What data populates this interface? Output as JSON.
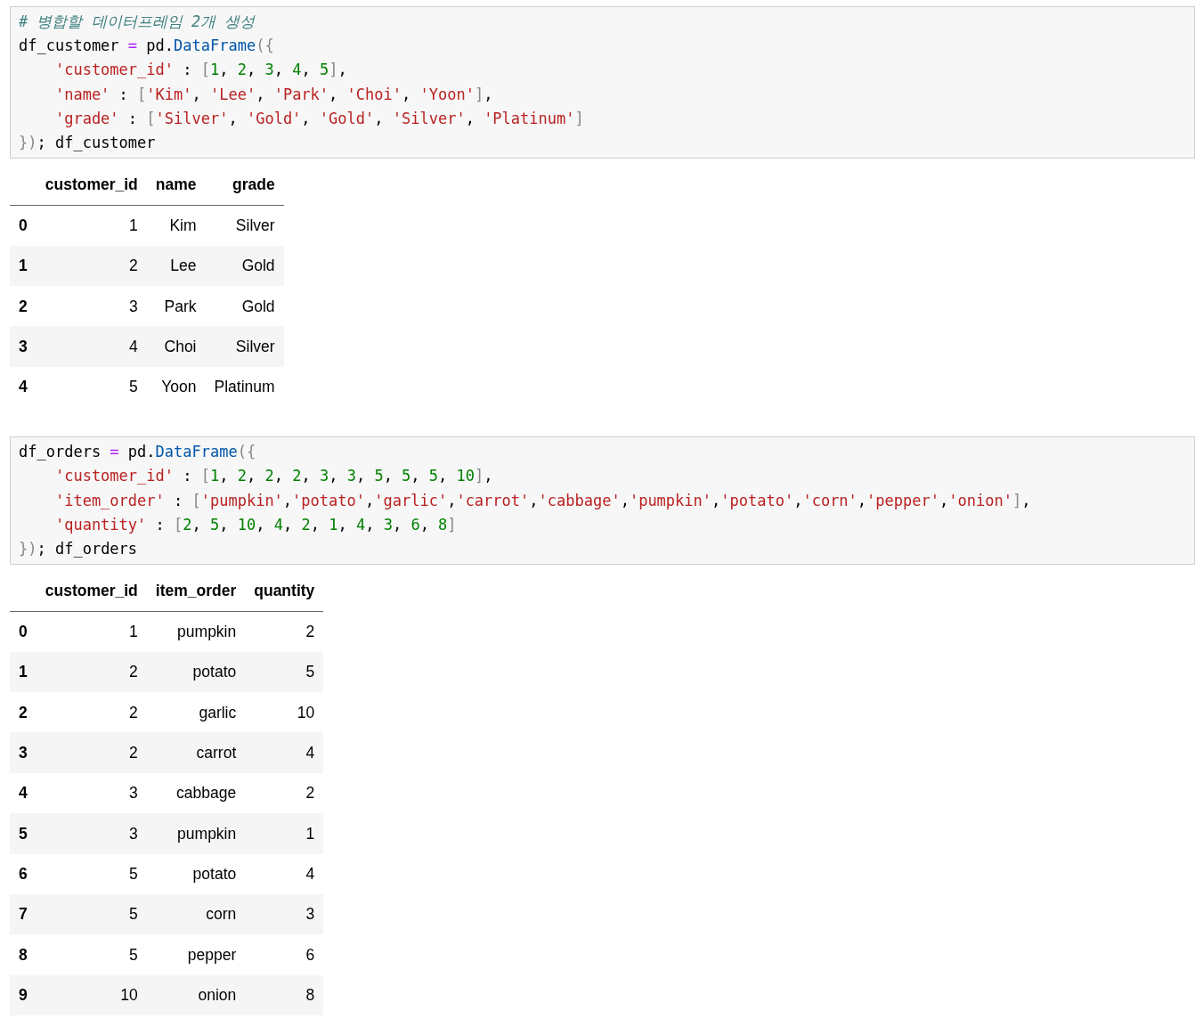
{
  "cells": [
    {
      "code": [
        {
          "indent": false,
          "tokens": [
            {
              "kind": "comment",
              "text": "# 병합할 데이터프레임 2개 생성"
            }
          ]
        },
        {
          "indent": false,
          "tokens": [
            {
              "kind": "plain",
              "text": "df_customer "
            },
            {
              "kind": "op",
              "text": "="
            },
            {
              "kind": "plain",
              "text": " pd."
            },
            {
              "kind": "attr",
              "text": "DataFrame"
            },
            {
              "kind": "punct",
              "text": "({"
            }
          ]
        },
        {
          "indent": true,
          "tokens": [
            {
              "kind": "str",
              "text": "'customer_id'"
            },
            {
              "kind": "plain",
              "text": " : "
            },
            {
              "kind": "punct",
              "text": "["
            },
            {
              "kind": "num",
              "text": "1"
            },
            {
              "kind": "plain",
              "text": ", "
            },
            {
              "kind": "num",
              "text": "2"
            },
            {
              "kind": "plain",
              "text": ", "
            },
            {
              "kind": "num",
              "text": "3"
            },
            {
              "kind": "plain",
              "text": ", "
            },
            {
              "kind": "num",
              "text": "4"
            },
            {
              "kind": "plain",
              "text": ", "
            },
            {
              "kind": "num",
              "text": "5"
            },
            {
              "kind": "punct",
              "text": "]"
            },
            {
              "kind": "plain",
              "text": ","
            }
          ]
        },
        {
          "indent": true,
          "tokens": [
            {
              "kind": "str",
              "text": "'name'"
            },
            {
              "kind": "plain",
              "text": " : "
            },
            {
              "kind": "punct",
              "text": "["
            },
            {
              "kind": "str",
              "text": "'Kim'"
            },
            {
              "kind": "plain",
              "text": ", "
            },
            {
              "kind": "str",
              "text": "'Lee'"
            },
            {
              "kind": "plain",
              "text": ", "
            },
            {
              "kind": "str",
              "text": "'Park'"
            },
            {
              "kind": "plain",
              "text": ", "
            },
            {
              "kind": "str",
              "text": "'Choi'"
            },
            {
              "kind": "plain",
              "text": ", "
            },
            {
              "kind": "str",
              "text": "'Yoon'"
            },
            {
              "kind": "punct",
              "text": "]"
            },
            {
              "kind": "plain",
              "text": ","
            }
          ]
        },
        {
          "indent": true,
          "tokens": [
            {
              "kind": "str",
              "text": "'grade'"
            },
            {
              "kind": "plain",
              "text": " : "
            },
            {
              "kind": "punct",
              "text": "["
            },
            {
              "kind": "str",
              "text": "'Silver'"
            },
            {
              "kind": "plain",
              "text": ", "
            },
            {
              "kind": "str",
              "text": "'Gold'"
            },
            {
              "kind": "plain",
              "text": ", "
            },
            {
              "kind": "str",
              "text": "'Gold'"
            },
            {
              "kind": "plain",
              "text": ", "
            },
            {
              "kind": "str",
              "text": "'Silver'"
            },
            {
              "kind": "plain",
              "text": ", "
            },
            {
              "kind": "str",
              "text": "'Platinum'"
            },
            {
              "kind": "punct",
              "text": "]"
            }
          ]
        },
        {
          "indent": false,
          "tokens": [
            {
              "kind": "punct",
              "text": "})"
            },
            {
              "kind": "plain",
              "text": "; df_customer"
            }
          ]
        }
      ],
      "table": {
        "columns": [
          "",
          "customer_id",
          "name",
          "grade"
        ],
        "rows": [
          [
            "0",
            "1",
            "Kim",
            "Silver"
          ],
          [
            "1",
            "2",
            "Lee",
            "Gold"
          ],
          [
            "2",
            "3",
            "Park",
            "Gold"
          ],
          [
            "3",
            "4",
            "Choi",
            "Silver"
          ],
          [
            "4",
            "5",
            "Yoon",
            "Platinum"
          ]
        ]
      }
    },
    {
      "code": [
        {
          "indent": false,
          "tokens": [
            {
              "kind": "plain",
              "text": "df_orders "
            },
            {
              "kind": "op",
              "text": "="
            },
            {
              "kind": "plain",
              "text": " pd."
            },
            {
              "kind": "attr",
              "text": "DataFrame"
            },
            {
              "kind": "punct",
              "text": "({"
            }
          ]
        },
        {
          "indent": true,
          "tokens": [
            {
              "kind": "str",
              "text": "'customer_id'"
            },
            {
              "kind": "plain",
              "text": " : "
            },
            {
              "kind": "punct",
              "text": "["
            },
            {
              "kind": "num",
              "text": "1"
            },
            {
              "kind": "plain",
              "text": ", "
            },
            {
              "kind": "num",
              "text": "2"
            },
            {
              "kind": "plain",
              "text": ", "
            },
            {
              "kind": "num",
              "text": "2"
            },
            {
              "kind": "plain",
              "text": ", "
            },
            {
              "kind": "num",
              "text": "2"
            },
            {
              "kind": "plain",
              "text": ", "
            },
            {
              "kind": "num",
              "text": "3"
            },
            {
              "kind": "plain",
              "text": ", "
            },
            {
              "kind": "num",
              "text": "3"
            },
            {
              "kind": "plain",
              "text": ", "
            },
            {
              "kind": "num",
              "text": "5"
            },
            {
              "kind": "plain",
              "text": ", "
            },
            {
              "kind": "num",
              "text": "5"
            },
            {
              "kind": "plain",
              "text": ", "
            },
            {
              "kind": "num",
              "text": "5"
            },
            {
              "kind": "plain",
              "text": ", "
            },
            {
              "kind": "num",
              "text": "10"
            },
            {
              "kind": "punct",
              "text": "]"
            },
            {
              "kind": "plain",
              "text": ","
            }
          ]
        },
        {
          "indent": true,
          "tokens": [
            {
              "kind": "str",
              "text": "'item_order'"
            },
            {
              "kind": "plain",
              "text": " : "
            },
            {
              "kind": "punct",
              "text": "["
            },
            {
              "kind": "str",
              "text": "'pumpkin'"
            },
            {
              "kind": "plain",
              "text": ","
            },
            {
              "kind": "str",
              "text": "'potato'"
            },
            {
              "kind": "plain",
              "text": ","
            },
            {
              "kind": "str",
              "text": "'garlic'"
            },
            {
              "kind": "plain",
              "text": ","
            },
            {
              "kind": "str",
              "text": "'carrot'"
            },
            {
              "kind": "plain",
              "text": ","
            },
            {
              "kind": "str",
              "text": "'cabbage'"
            },
            {
              "kind": "plain",
              "text": ","
            },
            {
              "kind": "str",
              "text": "'pumpkin'"
            },
            {
              "kind": "plain",
              "text": ","
            },
            {
              "kind": "str",
              "text": "'potato'"
            },
            {
              "kind": "plain",
              "text": ","
            },
            {
              "kind": "str",
              "text": "'corn'"
            },
            {
              "kind": "plain",
              "text": ","
            },
            {
              "kind": "str",
              "text": "'pepper'"
            },
            {
              "kind": "plain",
              "text": ","
            },
            {
              "kind": "str",
              "text": "'onion'"
            },
            {
              "kind": "punct",
              "text": "]"
            },
            {
              "kind": "plain",
              "text": ","
            }
          ]
        },
        {
          "indent": true,
          "tokens": [
            {
              "kind": "str",
              "text": "'quantity'"
            },
            {
              "kind": "plain",
              "text": " : "
            },
            {
              "kind": "punct",
              "text": "["
            },
            {
              "kind": "num",
              "text": "2"
            },
            {
              "kind": "plain",
              "text": ", "
            },
            {
              "kind": "num",
              "text": "5"
            },
            {
              "kind": "plain",
              "text": ", "
            },
            {
              "kind": "num",
              "text": "10"
            },
            {
              "kind": "plain",
              "text": ", "
            },
            {
              "kind": "num",
              "text": "4"
            },
            {
              "kind": "plain",
              "text": ", "
            },
            {
              "kind": "num",
              "text": "2"
            },
            {
              "kind": "plain",
              "text": ", "
            },
            {
              "kind": "num",
              "text": "1"
            },
            {
              "kind": "plain",
              "text": ", "
            },
            {
              "kind": "num",
              "text": "4"
            },
            {
              "kind": "plain",
              "text": ", "
            },
            {
              "kind": "num",
              "text": "3"
            },
            {
              "kind": "plain",
              "text": ", "
            },
            {
              "kind": "num",
              "text": "6"
            },
            {
              "kind": "plain",
              "text": ", "
            },
            {
              "kind": "num",
              "text": "8"
            },
            {
              "kind": "punct",
              "text": "]"
            }
          ]
        },
        {
          "indent": false,
          "tokens": [
            {
              "kind": "punct",
              "text": "})"
            },
            {
              "kind": "plain",
              "text": "; df_orders"
            }
          ]
        }
      ],
      "table": {
        "columns": [
          "",
          "customer_id",
          "item_order",
          "quantity"
        ],
        "rows": [
          [
            "0",
            "1",
            "pumpkin",
            "2"
          ],
          [
            "1",
            "2",
            "potato",
            "5"
          ],
          [
            "2",
            "2",
            "garlic",
            "10"
          ],
          [
            "3",
            "2",
            "carrot",
            "4"
          ],
          [
            "4",
            "3",
            "cabbage",
            "2"
          ],
          [
            "5",
            "3",
            "pumpkin",
            "1"
          ],
          [
            "6",
            "5",
            "potato",
            "4"
          ],
          [
            "7",
            "5",
            "corn",
            "3"
          ],
          [
            "8",
            "5",
            "pepper",
            "6"
          ],
          [
            "9",
            "10",
            "onion",
            "8"
          ]
        ]
      }
    }
  ]
}
